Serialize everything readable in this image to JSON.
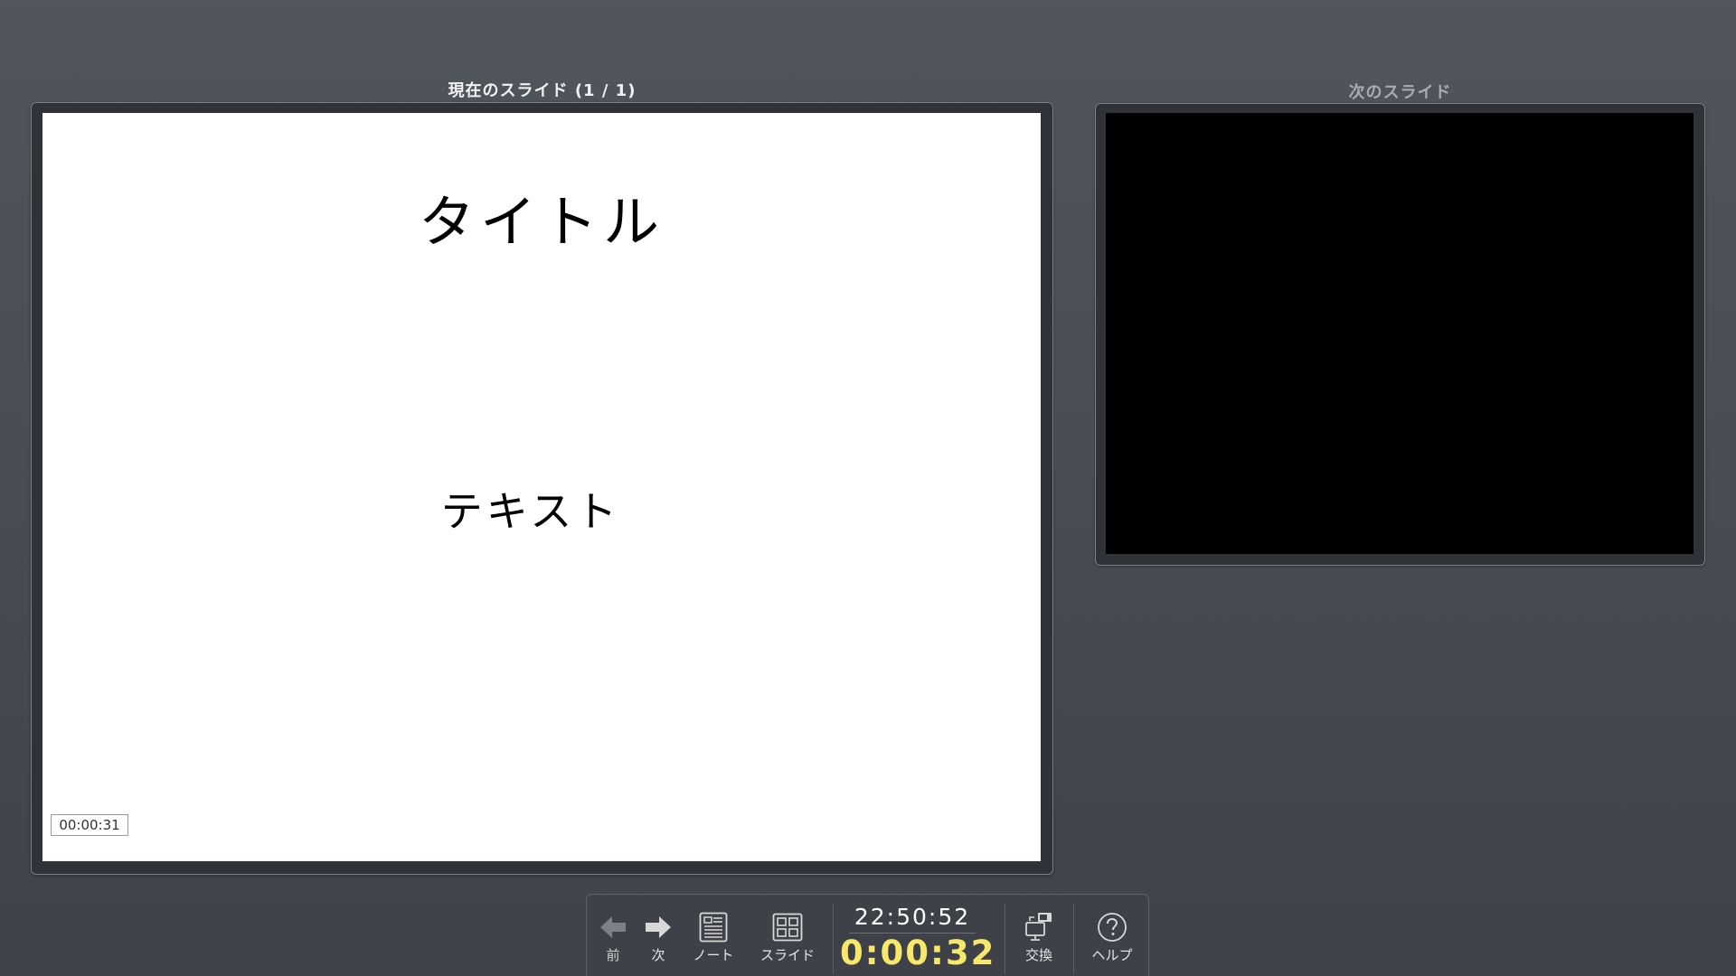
{
  "current_panel": {
    "heading": "現在のスライド (1 / 1)",
    "slide": {
      "title": "タイトル",
      "text": "テキスト",
      "timer": "00:00:31"
    }
  },
  "next_panel": {
    "heading": "次のスライド"
  },
  "toolbar": {
    "prev_label": "前",
    "next_label": "次",
    "notes_label": "ノート",
    "slides_label": "スライド",
    "clock": "22:50:52",
    "elapsed": "0:00:32",
    "swap_label": "交換",
    "help_label": "ヘルプ"
  },
  "colors": {
    "elapsed_timer": "#f7e76b",
    "background": "#4a4f56"
  },
  "icons": {
    "prev": "left-arrow-icon",
    "next": "right-arrow-icon",
    "notes": "notes-icon",
    "slides": "grid-icon",
    "swap": "monitor-swap-icon",
    "help": "question-circle-icon"
  }
}
